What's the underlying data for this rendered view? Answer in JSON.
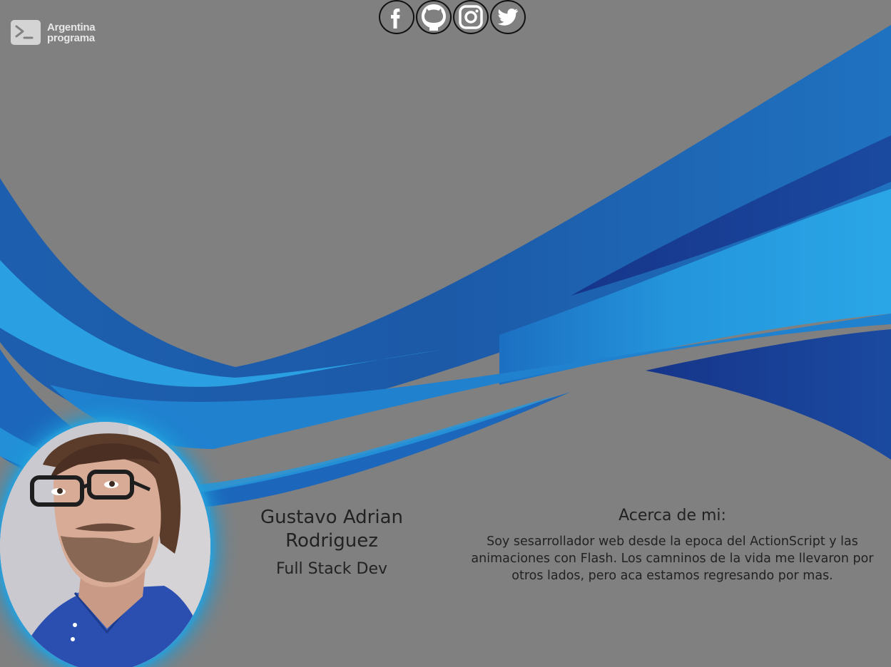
{
  "logo": {
    "line1": "Argentina",
    "line2": "programa",
    "icon": "terminal-icon"
  },
  "socials": [
    {
      "name": "Facebook",
      "icon": "facebook-icon"
    },
    {
      "name": "GitHub",
      "icon": "github-icon"
    },
    {
      "name": "Instagram",
      "icon": "instagram-icon"
    },
    {
      "name": "Twitter",
      "icon": "twitter-icon"
    }
  ],
  "profile": {
    "name_line1": "Gustavo Adrian",
    "name_line2": "Rodriguez",
    "role": "Full Stack Dev"
  },
  "about": {
    "title": "Acerca de mi:",
    "body": "Soy sesarrollador web desde la epoca del ActionScript y las animaciones con Flash. Los camninos de la vida me llevaron por otros lados, pero aca estamos regresando por mas."
  },
  "colors": {
    "background": "#808080",
    "wave_dark": "#1a3f8a",
    "wave_mid": "#1f6fc2",
    "wave_light": "#2aa4e6",
    "avatar_glow": "#1e9bd8",
    "text": "#222222"
  }
}
